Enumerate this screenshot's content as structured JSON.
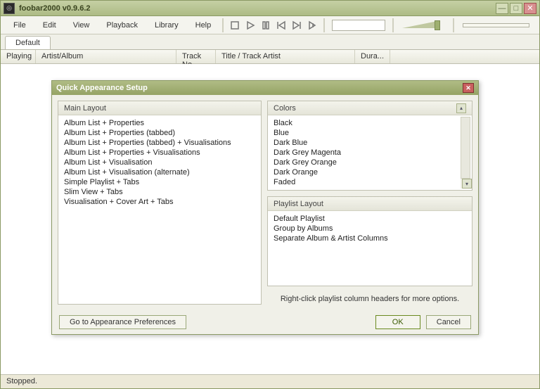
{
  "window": {
    "title": "foobar2000 v0.9.6.2"
  },
  "menu": {
    "file": "File",
    "edit": "Edit",
    "view": "View",
    "playback": "Playback",
    "library": "Library",
    "help": "Help"
  },
  "tabs": {
    "default": "Default"
  },
  "columns": {
    "playing": "Playing",
    "artist": "Artist/Album",
    "trackno": "Track No",
    "title": "Title / Track Artist",
    "dura": "Dura..."
  },
  "status": {
    "text": "Stopped."
  },
  "dialog": {
    "title": "Quick Appearance Setup",
    "mainlayout_header": "Main Layout",
    "mainlayout_items": [
      "Album List + Properties",
      "Album List + Properties (tabbed)",
      "Album List + Properties (tabbed) + Visualisations",
      "Album List + Properties + Visualisations",
      "Album List + Visualisation",
      "Album List + Visualisation (alternate)",
      "Simple Playlist + Tabs",
      "Slim View + Tabs",
      "Visualisation + Cover Art + Tabs"
    ],
    "colors_header": "Colors",
    "colors_items": [
      "Black",
      "Blue",
      "Dark Blue",
      "Dark Grey Magenta",
      "Dark Grey Orange",
      "Dark Orange",
      "Faded"
    ],
    "playlist_header": "Playlist Layout",
    "playlist_items": [
      "Default Playlist",
      "Group by Albums",
      "Separate Album & Artist Columns"
    ],
    "hint": "Right-click playlist column headers for more options.",
    "goto_prefs": "Go to Appearance Preferences",
    "ok": "OK",
    "cancel": "Cancel"
  }
}
